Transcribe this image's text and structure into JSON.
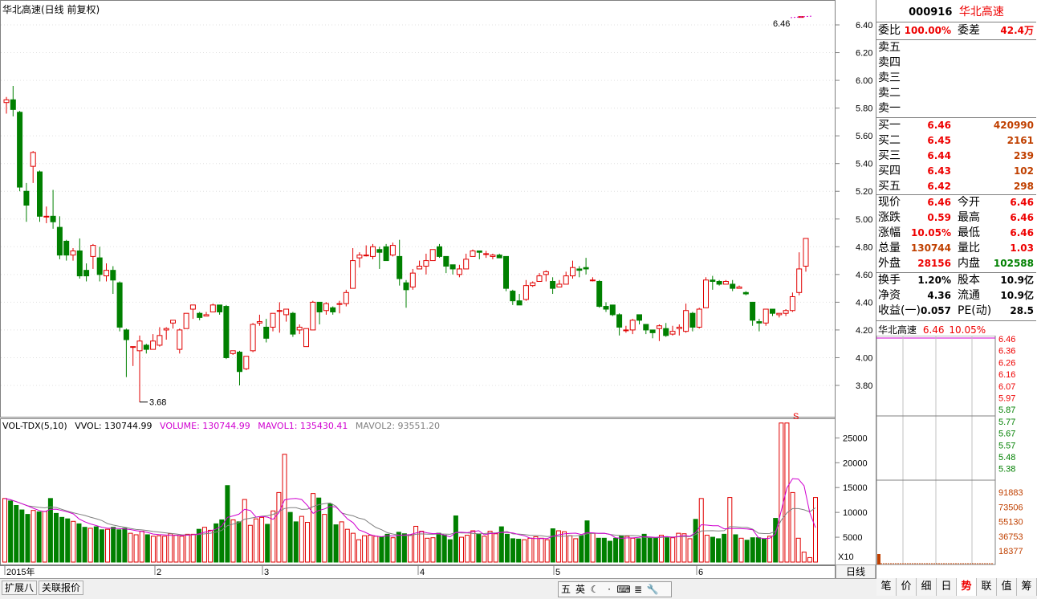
{
  "chart": {
    "title": "华北高速(日线 前复权)",
    "price_ticks": [
      "6.40",
      "6.20",
      "6.00",
      "5.80",
      "5.60",
      "5.40",
      "5.20",
      "5.00",
      "4.80",
      "4.60",
      "4.40",
      "4.20",
      "4.00",
      "3.80"
    ],
    "low_marker": "3.68",
    "high_marker": "6.46",
    "vol_ticks": [
      "25000",
      "20000",
      "15000",
      "10000",
      "5000"
    ],
    "vol_unit": "X10",
    "x_labels": [
      "2015年",
      "2",
      "3",
      "4",
      "5",
      "6"
    ],
    "period_label": "日线",
    "signal_mark": "S",
    "vol_legend": {
      "name": "VOL-TDX(5,10)",
      "vvol": "VVOL: 130744.99",
      "volume": "VOLUME: 130744.99",
      "mavol1": "MAVOL1: 135430.41",
      "mavol2": "MAVOL2: 93551.20"
    },
    "colors": {
      "up": "#e00000",
      "down": "#008000",
      "ma1": "#d000d0",
      "ma2": "#808080",
      "grid": "#ccc"
    }
  },
  "chart_data": {
    "type": "candlestick",
    "candles": [
      [
        5.84,
        5.86,
        5.76,
        5.88
      ],
      [
        5.86,
        5.79,
        5.74,
        5.96
      ],
      [
        5.77,
        5.23,
        5.2,
        5.78
      ],
      [
        5.2,
        5.1,
        4.98,
        5.26
      ],
      [
        5.38,
        5.48,
        5.26,
        5.49
      ],
      [
        5.34,
        5.02,
        4.98,
        5.35
      ],
      [
        5.02,
        5.02,
        4.97,
        5.09
      ],
      [
        5.02,
        4.98,
        4.93,
        5.21
      ],
      [
        4.94,
        4.74,
        4.71,
        5.02
      ],
      [
        4.84,
        4.74,
        4.7,
        4.85
      ],
      [
        4.74,
        4.77,
        4.7,
        4.79
      ],
      [
        4.77,
        4.59,
        4.57,
        4.86
      ],
      [
        4.63,
        4.59,
        4.55,
        4.68
      ],
      [
        4.73,
        4.81,
        4.64,
        4.82
      ],
      [
        4.72,
        4.6,
        4.55,
        4.8
      ],
      [
        4.59,
        4.63,
        4.55,
        4.68
      ],
      [
        4.63,
        4.56,
        4.46,
        4.66
      ],
      [
        4.54,
        4.22,
        4.19,
        4.55
      ],
      [
        4.2,
        4.13,
        3.86,
        4.21
      ],
      [
        4.08,
        4.08,
        3.94,
        4.08
      ],
      [
        4.05,
        4.12,
        3.68,
        4.16
      ],
      [
        4.09,
        4.06,
        4.03,
        4.1
      ],
      [
        4.06,
        4.12,
        4.06,
        4.17
      ],
      [
        4.09,
        4.16,
        4.08,
        4.22
      ],
      [
        4.2,
        4.21,
        4.13,
        4.22
      ],
      [
        4.25,
        4.27,
        4.21,
        4.27
      ],
      [
        4.06,
        4.2,
        4.03,
        4.21
      ],
      [
        4.21,
        4.32,
        4.21,
        4.32
      ],
      [
        4.35,
        4.38,
        4.28,
        4.38
      ],
      [
        4.32,
        4.29,
        4.27,
        4.33
      ],
      [
        4.3,
        4.31,
        4.3,
        4.33
      ],
      [
        4.33,
        4.38,
        4.33,
        4.39
      ],
      [
        4.38,
        4.33,
        4.31,
        4.38
      ],
      [
        4.37,
        4.0,
        3.99,
        4.38
      ],
      [
        4.03,
        4.05,
        4.02,
        4.05
      ],
      [
        4.04,
        3.9,
        3.8,
        4.05
      ],
      [
        3.92,
        4.01,
        3.91,
        4.01
      ],
      [
        4.05,
        4.24,
        4.04,
        4.25
      ],
      [
        4.25,
        4.26,
        4.23,
        4.31
      ],
      [
        4.22,
        4.14,
        4.11,
        4.28
      ],
      [
        4.22,
        4.32,
        4.19,
        4.32
      ],
      [
        4.34,
        4.34,
        4.18,
        4.4
      ],
      [
        4.31,
        4.35,
        4.26,
        4.35
      ],
      [
        4.32,
        4.17,
        4.15,
        4.33
      ],
      [
        4.2,
        4.22,
        4.17,
        4.24
      ],
      [
        4.08,
        4.21,
        4.09,
        4.2
      ],
      [
        4.2,
        4.4,
        4.2,
        4.41
      ],
      [
        4.4,
        4.33,
        4.24,
        4.4
      ],
      [
        4.34,
        4.39,
        4.31,
        4.4
      ],
      [
        4.36,
        4.33,
        4.31,
        4.37
      ],
      [
        4.39,
        4.39,
        4.32,
        4.41
      ],
      [
        4.39,
        4.47,
        4.37,
        4.49
      ],
      [
        4.5,
        4.7,
        4.5,
        4.79
      ],
      [
        4.72,
        4.74,
        4.65,
        4.76
      ],
      [
        4.74,
        4.74,
        4.73,
        4.81
      ],
      [
        4.73,
        4.8,
        4.71,
        4.82
      ],
      [
        4.78,
        4.76,
        4.64,
        4.8
      ],
      [
        4.8,
        4.7,
        4.7,
        4.82
      ],
      [
        4.74,
        4.81,
        4.73,
        4.83
      ],
      [
        4.73,
        4.57,
        4.52,
        4.85
      ],
      [
        4.54,
        4.49,
        4.36,
        4.56
      ],
      [
        4.51,
        4.61,
        4.49,
        4.64
      ],
      [
        4.64,
        4.66,
        4.64,
        4.7
      ],
      [
        4.66,
        4.7,
        4.6,
        4.75
      ],
      [
        4.7,
        4.78,
        4.7,
        4.78
      ],
      [
        4.8,
        4.73,
        4.72,
        4.82
      ],
      [
        4.73,
        4.66,
        4.61,
        4.73
      ],
      [
        4.67,
        4.64,
        4.6,
        4.67
      ],
      [
        4.6,
        4.64,
        4.58,
        4.67
      ],
      [
        4.64,
        4.71,
        4.64,
        4.75
      ],
      [
        4.73,
        4.77,
        4.73,
        4.78
      ],
      [
        4.77,
        4.76,
        4.71,
        4.77
      ],
      [
        4.75,
        4.75,
        4.72,
        4.77
      ],
      [
        4.73,
        4.74,
        4.71,
        4.75
      ],
      [
        4.74,
        4.72,
        4.72,
        4.75
      ],
      [
        4.73,
        4.5,
        4.48,
        4.73
      ],
      [
        4.48,
        4.41,
        4.38,
        4.49
      ],
      [
        4.41,
        4.38,
        4.38,
        4.46
      ],
      [
        4.42,
        4.52,
        4.41,
        4.56
      ],
      [
        4.52,
        4.54,
        4.51,
        4.55
      ],
      [
        4.55,
        4.59,
        4.55,
        4.61
      ],
      [
        4.6,
        4.62,
        4.55,
        4.63
      ],
      [
        4.55,
        4.5,
        4.46,
        4.58
      ],
      [
        4.51,
        4.53,
        4.51,
        4.56
      ],
      [
        4.53,
        4.59,
        4.53,
        4.62
      ],
      [
        4.59,
        4.65,
        4.57,
        4.7
      ],
      [
        4.64,
        4.63,
        4.58,
        4.66
      ],
      [
        4.65,
        4.64,
        4.6,
        4.72
      ],
      [
        4.56,
        4.56,
        4.55,
        4.58
      ],
      [
        4.55,
        4.37,
        4.36,
        4.56
      ],
      [
        4.37,
        4.35,
        4.33,
        4.4
      ],
      [
        4.38,
        4.31,
        4.3,
        4.38
      ],
      [
        4.31,
        4.22,
        4.16,
        4.32
      ],
      [
        4.2,
        4.2,
        4.18,
        4.23
      ],
      [
        4.2,
        4.27,
        4.17,
        4.28
      ],
      [
        4.31,
        4.27,
        4.24,
        4.31
      ],
      [
        4.24,
        4.2,
        4.17,
        4.24
      ],
      [
        4.2,
        4.18,
        4.14,
        4.2
      ],
      [
        4.21,
        4.23,
        4.12,
        4.24
      ],
      [
        4.21,
        4.16,
        4.15,
        4.25
      ],
      [
        4.17,
        4.19,
        4.16,
        4.23
      ],
      [
        4.21,
        4.22,
        4.16,
        4.24
      ],
      [
        4.19,
        4.34,
        4.18,
        4.39
      ],
      [
        4.32,
        4.22,
        4.19,
        4.33
      ],
      [
        4.22,
        4.35,
        4.21,
        4.36
      ],
      [
        4.36,
        4.56,
        4.36,
        4.58
      ],
      [
        4.56,
        4.55,
        4.49,
        4.59
      ],
      [
        4.55,
        4.53,
        4.52,
        4.56
      ],
      [
        4.53,
        4.55,
        4.53,
        4.56
      ],
      [
        4.53,
        4.5,
        4.48,
        4.56
      ],
      [
        4.5,
        4.51,
        4.5,
        4.52
      ],
      [
        4.47,
        4.46,
        4.45,
        4.48
      ],
      [
        4.4,
        4.27,
        4.23,
        4.4
      ],
      [
        4.26,
        4.25,
        4.19,
        4.28
      ],
      [
        4.25,
        4.35,
        4.23,
        4.35
      ],
      [
        4.35,
        4.32,
        4.3,
        4.35
      ],
      [
        4.31,
        4.32,
        4.29,
        4.32
      ],
      [
        4.32,
        4.34,
        4.3,
        4.35
      ],
      [
        4.34,
        4.44,
        4.33,
        4.47
      ],
      [
        4.47,
        4.64,
        4.45,
        4.76
      ],
      [
        4.66,
        4.86,
        4.62,
        4.86
      ],
      [
        6.46,
        6.46,
        6.46,
        6.46
      ]
    ],
    "volume": [
      12800,
      12300,
      11400,
      10500,
      9600,
      10400,
      10100,
      10200,
      12800,
      9800,
      9000,
      8700,
      8200,
      7700,
      7000,
      6800,
      7100,
      6500,
      6600,
      7000,
      6500,
      6800,
      5800,
      5500,
      6200,
      5500,
      5200,
      5300,
      5200,
      5700,
      5400,
      5200,
      5600,
      5600,
      6600,
      7000,
      6400,
      7700,
      8500,
      15400,
      8500,
      8100,
      12600,
      7400,
      8700,
      9000,
      7600,
      10300,
      14000,
      21700,
      10000,
      8100,
      9200,
      8000,
      13800,
      12900,
      9600,
      11700,
      7500,
      8100,
      6600,
      5800,
      4500,
      5300,
      5400,
      5200,
      5100,
      5600,
      4900,
      6000,
      5700,
      5500,
      7200,
      6200,
      4800,
      4900,
      5800,
      5400,
      4500,
      9300,
      5000,
      5400,
      6300,
      5600,
      5200,
      6200,
      5700,
      7100,
      5600,
      4700,
      4600,
      4500,
      4800,
      5100,
      4800,
      4500,
      6700,
      6300,
      6100,
      5300,
      4700,
      5300,
      8300,
      5800,
      4800,
      4800,
      4200,
      4800,
      5300,
      5200,
      4800,
      4700,
      5600,
      4900,
      4800,
      5400,
      4900,
      4900,
      5800,
      5700,
      4700,
      8600,
      12800,
      5400,
      5000,
      4700,
      5600,
      13000,
      5500,
      4800,
      4400,
      4900,
      4900,
      4600,
      5200,
      8800,
      28000,
      28000,
      14000,
      4800,
      2000,
      900,
      13000
    ]
  },
  "quote": {
    "code": "000916",
    "name": "华北高速",
    "wb_label": "委比",
    "wb_value": "100.00%",
    "wc_label": "委差",
    "wc_value": "42.4万",
    "sells": [
      {
        "label": "卖五",
        "price": "",
        "vol": ""
      },
      {
        "label": "卖四",
        "price": "",
        "vol": ""
      },
      {
        "label": "卖三",
        "price": "",
        "vol": ""
      },
      {
        "label": "卖二",
        "price": "",
        "vol": ""
      },
      {
        "label": "卖一",
        "price": "",
        "vol": ""
      }
    ],
    "buys": [
      {
        "label": "买一",
        "price": "6.46",
        "vol": "420990"
      },
      {
        "label": "买二",
        "price": "6.45",
        "vol": "2161"
      },
      {
        "label": "买三",
        "price": "6.44",
        "vol": "239"
      },
      {
        "label": "买四",
        "price": "6.43",
        "vol": "102"
      },
      {
        "label": "买五",
        "price": "6.42",
        "vol": "298"
      }
    ],
    "stats": [
      {
        "l1": "现价",
        "v1": "6.46",
        "l2": "今开",
        "v2": "6.46"
      },
      {
        "l1": "涨跌",
        "v1": "0.59",
        "l2": "最高",
        "v2": "6.46"
      },
      {
        "l1": "涨幅",
        "v1": "10.05%",
        "l2": "最低",
        "v2": "6.46"
      },
      {
        "l1": "总量",
        "v1": "130744",
        "l2": "量比",
        "v2": "1.03"
      },
      {
        "l1": "外盘",
        "v1": "28156",
        "l2": "内盘",
        "v2": "102588"
      }
    ],
    "fund": [
      {
        "l1": "换手",
        "v1": "1.20%",
        "l2": "股本",
        "v2": "10.9亿"
      },
      {
        "l1": "净资",
        "v1": "4.36",
        "l2": "流通",
        "v2": "10.9亿"
      },
      {
        "l1": "收益(一)",
        "v1": "0.057",
        "l2": "PE(动)",
        "v2": "28.5"
      }
    ],
    "mini_title": "华北高速",
    "mini_price": "6.46",
    "mini_pct": "10.05%",
    "mini_price_ticks": [
      "6.46",
      "6.36",
      "6.26",
      "6.16",
      "6.07",
      "5.97",
      "5.87",
      "5.77",
      "5.67",
      "5.57",
      "5.48",
      "5.38"
    ],
    "mini_vol_ticks": [
      "91883",
      "73506",
      "55130",
      "36753",
      "18377"
    ]
  },
  "bottom": {
    "left_tabs": [
      "扩展八",
      "关联报价"
    ],
    "ime_items": [
      "五",
      "英",
      "☾",
      "⋅",
      "⌨",
      "≣",
      "🔧"
    ],
    "right_tabs": [
      "笔",
      "价",
      "细",
      "日",
      "势",
      "联",
      "值",
      "筹"
    ],
    "active_right": "势"
  }
}
